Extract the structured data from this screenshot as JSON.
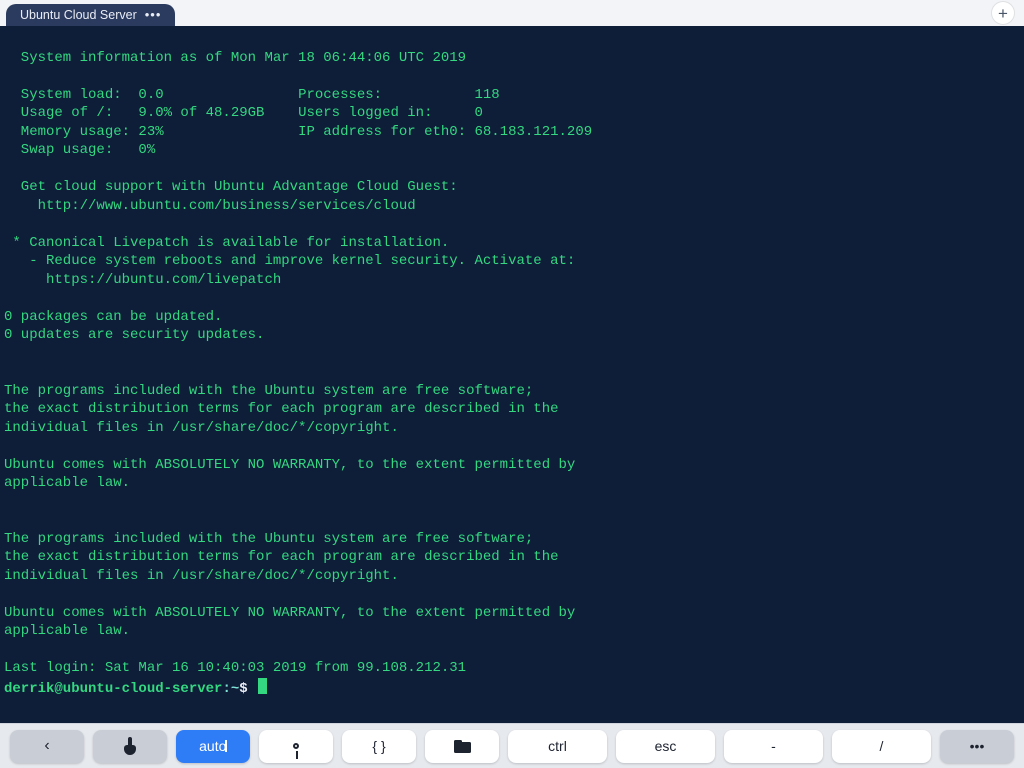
{
  "tab": {
    "title": "Ubuntu Cloud Server",
    "menu_glyph": "•••"
  },
  "motd": {
    "sysinfo_header": "  System information as of Mon Mar 18 06:44:06 UTC 2019",
    "col_load_label": "  System load:  ",
    "col_load_value": "0.0",
    "col_proc_label": "Processes:          ",
    "col_proc_value": "118",
    "col_usage_label": "  Usage of /:   ",
    "col_usage_value": "9.0% of 48.29GB",
    "col_users_label": "Users logged in:    ",
    "col_users_value": "0",
    "col_mem_label": "  Memory usage: ",
    "col_mem_value": "23%",
    "col_ip_label": "IP address for eth0: ",
    "col_ip_value": "68.183.121.209",
    "col_swap_label": "  Swap usage:   ",
    "col_swap_value": "0%",
    "cloud_support_1": "  Get cloud support with Ubuntu Advantage Cloud Guest:",
    "cloud_support_2": "    http://www.ubuntu.com/business/services/cloud",
    "livepatch_1": " * Canonical Livepatch is available for installation.",
    "livepatch_2": "   - Reduce system reboots and improve kernel security. Activate at:",
    "livepatch_3": "     https://ubuntu.com/livepatch",
    "updates_1": "0 packages can be updated.",
    "updates_2": "0 updates are security updates.",
    "legal_1": "The programs included with the Ubuntu system are free software;",
    "legal_2": "the exact distribution terms for each program are described in the",
    "legal_3": "individual files in /usr/share/doc/*/copyright.",
    "warranty_1": "Ubuntu comes with ABSOLUTELY NO WARRANTY, to the extent permitted by",
    "warranty_2": "applicable law.",
    "last_login": "Last login: Sat Mar 16 10:40:03 2019 from 99.108.212.31"
  },
  "prompt": {
    "user_host": "derrik@ubuntu-cloud-server",
    "separator": ":",
    "path": "~",
    "dollar": "$"
  },
  "toolbar": {
    "back": "‹",
    "auto": "auto",
    "braces": "{ }",
    "ctrl": "ctrl",
    "esc": "esc",
    "dash": "-",
    "slash": "/",
    "more": "•••"
  }
}
